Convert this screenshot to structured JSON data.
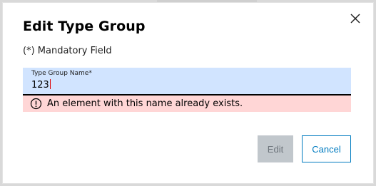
{
  "dialog": {
    "title": "Edit Type Group",
    "mandatory_note": "(*) Mandatory Field",
    "close_icon": "close-icon"
  },
  "form": {
    "type_group_name": {
      "label": "Type Group Name*",
      "value": "123"
    },
    "error": {
      "icon": "warning-circle-icon",
      "message": "An element with this name already exists."
    }
  },
  "actions": {
    "edit_label": "Edit",
    "cancel_label": "Cancel"
  },
  "colors": {
    "field_background": "#d1e4ff",
    "error_background": "#ffd6d6",
    "primary_blue": "#007bc0",
    "disabled_button": "#c1c7cc"
  }
}
